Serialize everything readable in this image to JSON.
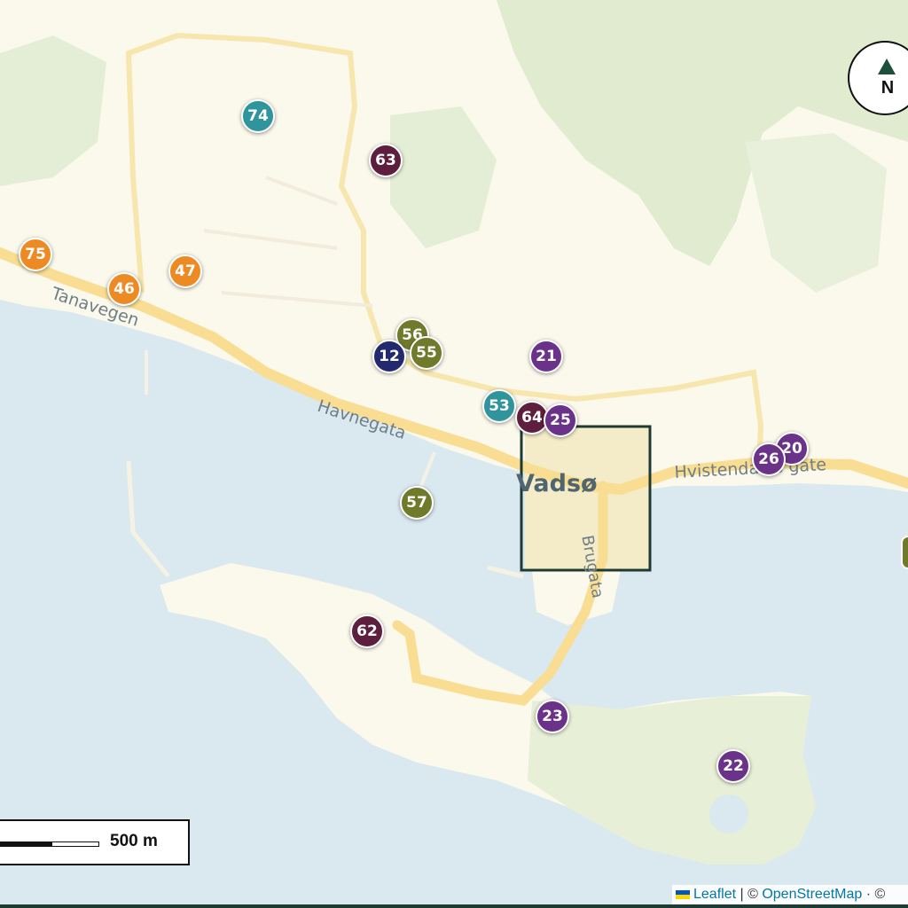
{
  "map": {
    "place_label": "Vadsø",
    "streets": {
      "tanavegen": "Tanavegen",
      "havnegata": "Havnegata",
      "hvistendahls": "Hvistendahls gate",
      "brugata": "Brugata"
    }
  },
  "markers": [
    {
      "label": "74",
      "color": "#2f949c"
    },
    {
      "label": "63",
      "color": "#5e1e3d"
    },
    {
      "label": "75",
      "color": "#ee8a24"
    },
    {
      "label": "47",
      "color": "#ee8a24"
    },
    {
      "label": "46",
      "color": "#ee8a24"
    },
    {
      "label": "56",
      "color": "#6f7a2a"
    },
    {
      "label": "12",
      "color": "#22296e"
    },
    {
      "label": "55",
      "color": "#6f7a2a"
    },
    {
      "label": "21",
      "color": "#6a3389"
    },
    {
      "label": "53",
      "color": "#2f949c"
    },
    {
      "label": "64",
      "color": "#5e1e3d"
    },
    {
      "label": "25",
      "color": "#6a3389"
    },
    {
      "label": "20",
      "color": "#6a3389"
    },
    {
      "label": "26",
      "color": "#6a3389"
    },
    {
      "label": "57",
      "color": "#6f7a2a"
    },
    {
      "label": "62",
      "color": "#5e1e3d"
    },
    {
      "label": "23",
      "color": "#6a3389"
    },
    {
      "label": "22",
      "color": "#6a3389"
    }
  ],
  "compass": {
    "label": "N"
  },
  "scale": {
    "label": "500 m"
  },
  "attribution": {
    "leaflet": "Leaflet",
    "sep": " | © ",
    "osm": "OpenStreetMap",
    "tail": " · ©"
  },
  "colors": {
    "water": "#d9e9ef",
    "land": "#fbf8ec",
    "forest": "#dde9cd",
    "road": "#f9dd92",
    "highlight_box": "#1d3b33"
  }
}
